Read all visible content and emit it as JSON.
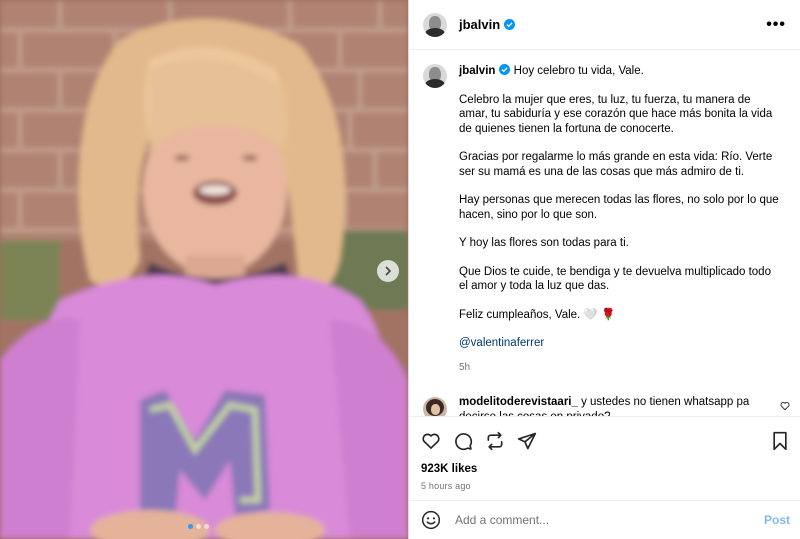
{
  "post": {
    "author": "jbalvin",
    "more_label": "•••",
    "caption_lines": [
      "Hoy celebro tu vida, Vale.",
      "Celebro la mujer que eres, tu luz, tu fuerza, tu manera de amar, tu sabiduría y ese corazón que hace más bonita la vida de quienes tienen la fortuna de conocerte.",
      "Gracias por regalarme lo más grande en esta vida: Río. Verte ser su mamá es una de las cosas que más admiro de ti.",
      "Hay personas que merecen todas las flores, no solo por lo que hacen, sino por lo que son.",
      "Y hoy las flores son todas para ti.",
      "Que Dios te cuide, te bendiga y te devuelva multiplicado todo el amor y toda la luz que das.",
      "Feliz cumpleaños, Vale. 🤍 🌹"
    ],
    "mention": "@valentinaferrer",
    "caption_time": "5h",
    "likes": "923K likes",
    "time_ago": "5 hours ago"
  },
  "comments": [
    {
      "username": "modelitoderevistaari_",
      "text": "y ustedes no tienen whatsapp pa decirse las cosas en privado?"
    }
  ],
  "add_comment": {
    "placeholder": "Add a comment...",
    "post_label": "Post"
  },
  "carousel": {
    "current_slide": 1,
    "slide_count": 3
  },
  "icons": {
    "verified": "verified-badge-icon",
    "like": "heart-icon",
    "comment": "comment-icon",
    "repost": "repost-icon",
    "share": "share-icon",
    "save": "bookmark-icon",
    "emoji": "emoji-icon",
    "next": "chevron-right-icon"
  },
  "colors": {
    "verified": "#0095f6",
    "link": "#00376b",
    "post_button": "#7fb9f4",
    "sweater": "#d98ad8"
  }
}
